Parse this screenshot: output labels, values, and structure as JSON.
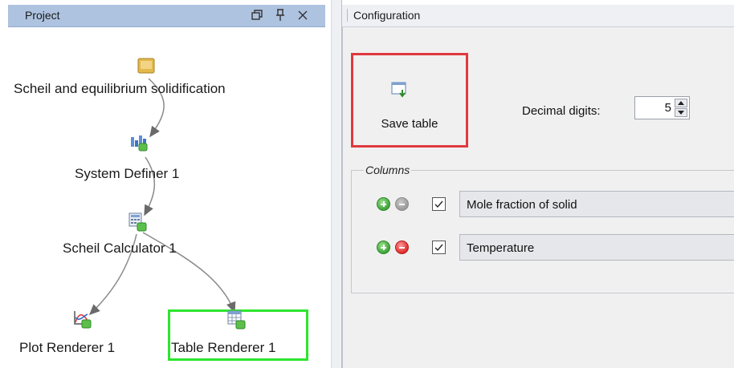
{
  "project_panel": {
    "title": "Project",
    "header_buttons": [
      "restore-icon",
      "pin-icon",
      "close-icon"
    ],
    "nodes": [
      {
        "label": "Scheil and equilibrium solidification",
        "icon": "project-folder-icon"
      },
      {
        "label": "System Definer 1",
        "icon": "system-definer-icon"
      },
      {
        "label": "Scheil Calculator 1",
        "icon": "calculator-icon"
      },
      {
        "label": "Plot Renderer 1",
        "icon": "plot-renderer-icon"
      },
      {
        "label": "Table Renderer 1",
        "icon": "table-renderer-icon",
        "selected": true
      }
    ],
    "selection_color": "#2ee52e"
  },
  "configuration_panel": {
    "title": "Configuration",
    "save_table_label": "Save table",
    "highlight_color": "#e0393e",
    "decimal_digits_label": "Decimal digits:",
    "decimal_digits_value": "5",
    "columns_title": "Columns",
    "columns": [
      {
        "value": "Mole fraction of solid",
        "checked": true,
        "remove_enabled": false
      },
      {
        "value": "Temperature",
        "checked": true,
        "remove_enabled": true
      }
    ]
  }
}
